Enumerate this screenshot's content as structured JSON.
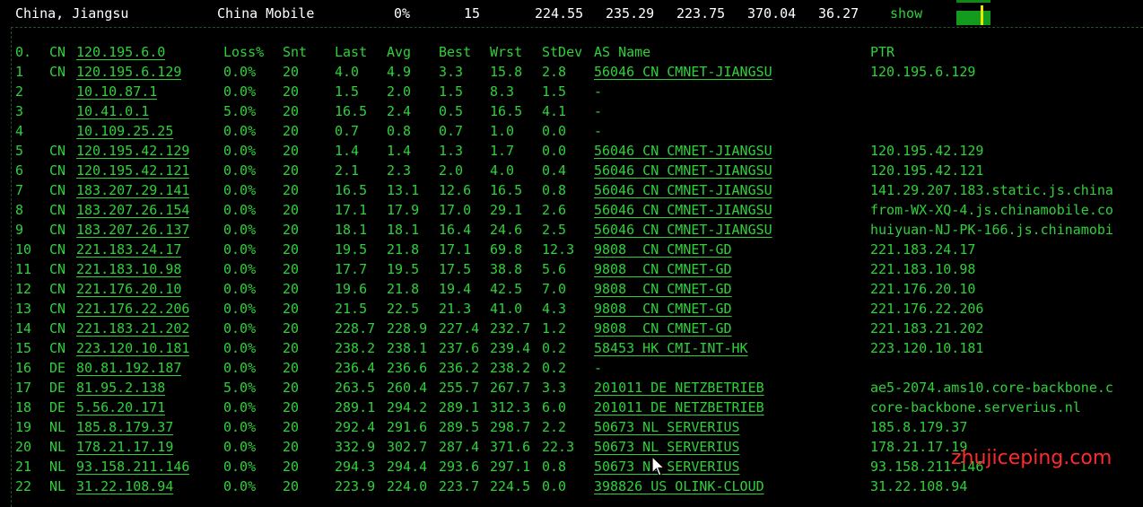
{
  "summary": {
    "location": "China, Jiangsu",
    "isp": "China Mobile",
    "loss": "0%",
    "sent": "15",
    "last": "224.55",
    "avg": "235.29",
    "best": "223.75",
    "worst": "370.04",
    "stdev": "36.27",
    "show_label": "show"
  },
  "headers": {
    "hop": "0.",
    "cc": "CN",
    "ip": "120.195.6.0",
    "loss": "Loss%",
    "snt": "Snt",
    "last": "Last",
    "avg": "Avg",
    "best": "Best",
    "wrst": "Wrst",
    "stdev": "StDev",
    "as": "AS Name",
    "ptr": "PTR"
  },
  "rows": [
    {
      "hop": "1",
      "cc": "CN",
      "ip": "120.195.6.129",
      "loss": "0.0%",
      "snt": "20",
      "last": "4.0",
      "avg": "4.9",
      "best": "3.3",
      "wrst": "15.8",
      "stdev": "2.8",
      "as": "56046 CN CMNET-JIANGSU",
      "ptr": "120.195.6.129"
    },
    {
      "hop": "2",
      "cc": "",
      "ip": "10.10.87.1",
      "loss": "0.0%",
      "snt": "20",
      "last": "1.5",
      "avg": "2.0",
      "best": "1.5",
      "wrst": "8.3",
      "stdev": "1.5",
      "as": "-",
      "ptr": ""
    },
    {
      "hop": "3",
      "cc": "",
      "ip": "10.41.0.1",
      "loss": "5.0%",
      "snt": "20",
      "last": "16.5",
      "avg": "2.4",
      "best": "0.5",
      "wrst": "16.5",
      "stdev": "4.1",
      "as": "-",
      "ptr": ""
    },
    {
      "hop": "4",
      "cc": "",
      "ip": "10.109.25.25",
      "loss": "0.0%",
      "snt": "20",
      "last": "0.7",
      "avg": "0.8",
      "best": "0.7",
      "wrst": "1.0",
      "stdev": "0.0",
      "as": "-",
      "ptr": ""
    },
    {
      "hop": "5",
      "cc": "CN",
      "ip": "120.195.42.129",
      "loss": "0.0%",
      "snt": "20",
      "last": "1.4",
      "avg": "1.4",
      "best": "1.3",
      "wrst": "1.7",
      "stdev": "0.0",
      "as": "56046 CN CMNET-JIANGSU",
      "ptr": "120.195.42.129"
    },
    {
      "hop": "6",
      "cc": "CN",
      "ip": "120.195.42.121",
      "loss": "0.0%",
      "snt": "20",
      "last": "2.1",
      "avg": "2.3",
      "best": "2.0",
      "wrst": "4.0",
      "stdev": "0.4",
      "as": "56046 CN CMNET-JIANGSU",
      "ptr": "120.195.42.121"
    },
    {
      "hop": "7",
      "cc": "CN",
      "ip": "183.207.29.141",
      "loss": "0.0%",
      "snt": "20",
      "last": "16.5",
      "avg": "13.1",
      "best": "12.6",
      "wrst": "16.5",
      "stdev": "0.8",
      "as": "56046 CN CMNET-JIANGSU",
      "ptr": "141.29.207.183.static.js.china"
    },
    {
      "hop": "8",
      "cc": "CN",
      "ip": "183.207.26.154",
      "loss": "0.0%",
      "snt": "20",
      "last": "17.1",
      "avg": "17.9",
      "best": "17.0",
      "wrst": "29.1",
      "stdev": "2.6",
      "as": "56046 CN CMNET-JIANGSU",
      "ptr": "from-WX-XQ-4.js.chinamobile.co"
    },
    {
      "hop": "9",
      "cc": "CN",
      "ip": "183.207.26.137",
      "loss": "0.0%",
      "snt": "20",
      "last": "18.1",
      "avg": "18.1",
      "best": "16.4",
      "wrst": "24.6",
      "stdev": "2.5",
      "as": "56046 CN CMNET-JIANGSU",
      "ptr": "huiyuan-NJ-PK-166.js.chinamobi"
    },
    {
      "hop": "10",
      "cc": "CN",
      "ip": "221.183.24.17",
      "loss": "0.0%",
      "snt": "20",
      "last": "19.5",
      "avg": "21.8",
      "best": "17.1",
      "wrst": "69.8",
      "stdev": "12.3",
      "as": "9808  CN CMNET-GD",
      "ptr": "221.183.24.17"
    },
    {
      "hop": "11",
      "cc": "CN",
      "ip": "221.183.10.98",
      "loss": "0.0%",
      "snt": "20",
      "last": "17.7",
      "avg": "19.5",
      "best": "17.5",
      "wrst": "38.8",
      "stdev": "5.6",
      "as": "9808  CN CMNET-GD",
      "ptr": "221.183.10.98"
    },
    {
      "hop": "12",
      "cc": "CN",
      "ip": "221.176.20.10",
      "loss": "0.0%",
      "snt": "20",
      "last": "19.6",
      "avg": "21.8",
      "best": "19.4",
      "wrst": "42.5",
      "stdev": "7.0",
      "as": "9808  CN CMNET-GD",
      "ptr": "221.176.20.10"
    },
    {
      "hop": "13",
      "cc": "CN",
      "ip": "221.176.22.206",
      "loss": "0.0%",
      "snt": "20",
      "last": "21.5",
      "avg": "22.5",
      "best": "21.3",
      "wrst": "41.0",
      "stdev": "4.3",
      "as": "9808  CN CMNET-GD",
      "ptr": "221.176.22.206"
    },
    {
      "hop": "14",
      "cc": "CN",
      "ip": "221.183.21.202",
      "loss": "0.0%",
      "snt": "20",
      "last": "228.7",
      "avg": "228.9",
      "best": "227.4",
      "wrst": "232.7",
      "stdev": "1.2",
      "as": "9808  CN CMNET-GD",
      "ptr": "221.183.21.202"
    },
    {
      "hop": "15",
      "cc": "CN",
      "ip": "223.120.10.181",
      "loss": "0.0%",
      "snt": "20",
      "last": "238.2",
      "avg": "238.1",
      "best": "237.6",
      "wrst": "239.4",
      "stdev": "0.2",
      "as": "58453 HK CMI-INT-HK",
      "ptr": "223.120.10.181"
    },
    {
      "hop": "16",
      "cc": "DE",
      "ip": "80.81.192.187",
      "loss": "0.0%",
      "snt": "20",
      "last": "236.4",
      "avg": "236.6",
      "best": "236.2",
      "wrst": "238.2",
      "stdev": "0.2",
      "as": "-",
      "ptr": ""
    },
    {
      "hop": "17",
      "cc": "DE",
      "ip": "81.95.2.138",
      "loss": "5.0%",
      "snt": "20",
      "last": "263.5",
      "avg": "260.4",
      "best": "255.7",
      "wrst": "267.7",
      "stdev": "3.3",
      "as": "201011 DE NETZBETRIEB",
      "ptr": "ae5-2074.ams10.core-backbone.c"
    },
    {
      "hop": "18",
      "cc": "DE",
      "ip": "5.56.20.171",
      "loss": "0.0%",
      "snt": "20",
      "last": "289.1",
      "avg": "294.2",
      "best": "289.1",
      "wrst": "312.3",
      "stdev": "6.0",
      "as": "201011 DE NETZBETRIEB",
      "ptr": "core-backbone.serverius.nl"
    },
    {
      "hop": "19",
      "cc": "NL",
      "ip": "185.8.179.37",
      "loss": "0.0%",
      "snt": "20",
      "last": "292.4",
      "avg": "291.6",
      "best": "289.5",
      "wrst": "298.7",
      "stdev": "2.2",
      "as": "50673 NL SERVERIUS",
      "ptr": "185.8.179.37"
    },
    {
      "hop": "20",
      "cc": "NL",
      "ip": "178.21.17.19",
      "loss": "0.0%",
      "snt": "20",
      "last": "332.9",
      "avg": "302.7",
      "best": "287.4",
      "wrst": "371.6",
      "stdev": "22.3",
      "as": "50673 NL SERVERIUS",
      "ptr": "178.21.17.19"
    },
    {
      "hop": "21",
      "cc": "NL",
      "ip": "93.158.211.146",
      "loss": "0.0%",
      "snt": "20",
      "last": "294.3",
      "avg": "294.4",
      "best": "293.6",
      "wrst": "297.1",
      "stdev": "0.8",
      "as": "50673 NL SERVERIUS",
      "ptr": "93.158.211.146"
    },
    {
      "hop": "22",
      "cc": "NL",
      "ip": "31.22.108.94",
      "loss": "0.0%",
      "snt": "20",
      "last": "223.9",
      "avg": "224.0",
      "best": "223.7",
      "wrst": "224.5",
      "stdev": "0.0",
      "as": "398826 US OLINK-CLOUD",
      "ptr": "31.22.108.94"
    }
  ],
  "watermark": "zhujiceping.com",
  "colors": {
    "text_green": "#2fd13a",
    "background": "#000000",
    "watermark_red": "#ff2a2a",
    "bar_green": "#139b1d",
    "bar_tick": "#e8e800"
  }
}
